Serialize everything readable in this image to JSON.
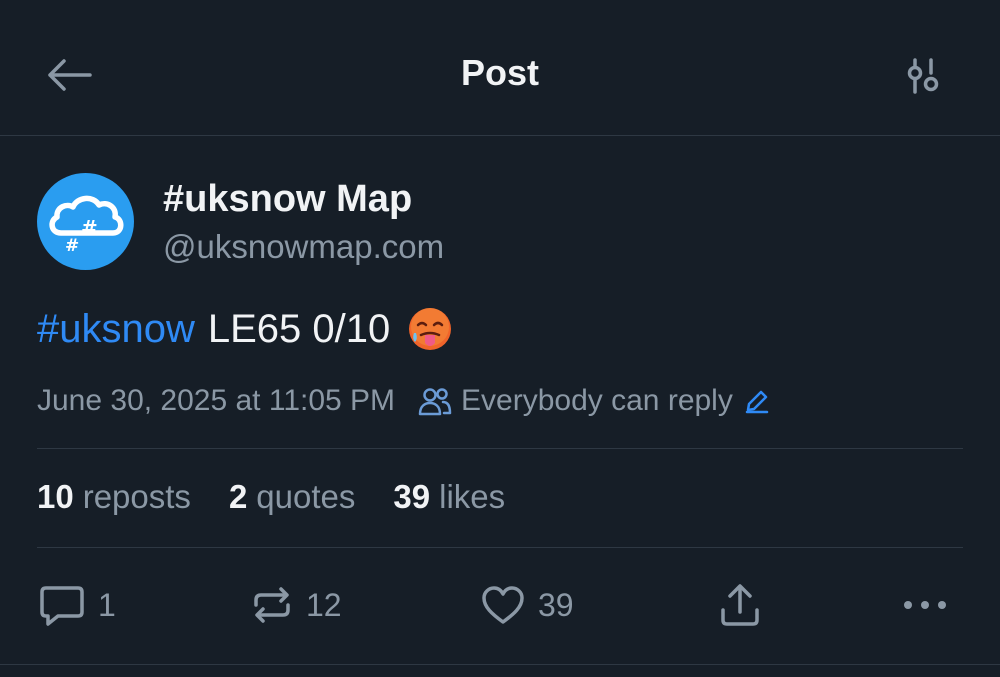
{
  "header": {
    "title": "Post",
    "back_icon": "arrow-left-icon",
    "settings_icon": "sliders-icon"
  },
  "author": {
    "display_name": "#uksnow Map",
    "handle": "@uksnowmap.com",
    "avatar_icon": "cloud-hashtag-icon"
  },
  "post": {
    "hashtag": "#uksnow",
    "text": "LE65 0/10",
    "emoji": "hot-face-emoji",
    "timestamp": "June 30, 2025 at 11:05 PM",
    "reply_setting": "Everybody can reply"
  },
  "stats": {
    "reposts_count": "10",
    "reposts_label": "reposts",
    "quotes_count": "2",
    "quotes_label": "quotes",
    "likes_count": "39",
    "likes_label": "likes"
  },
  "actions": {
    "reply_count": "1",
    "repost_count": "12",
    "like_count": "39"
  },
  "colors": {
    "background": "#161e27",
    "text": "#f1f3f5",
    "muted": "#8b98a5",
    "accent": "#2f8af5",
    "divider": "#2e3843",
    "avatar": "#2a9df0"
  }
}
